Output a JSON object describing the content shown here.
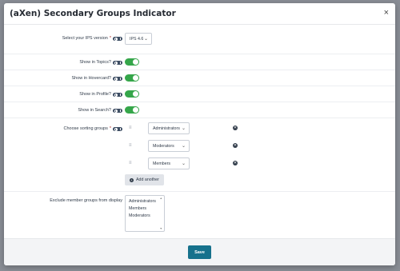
{
  "backdrop": {
    "edge_text": ""
  },
  "modal": {
    "title": "(aXen) Secondary Groups Indicator",
    "close_glyph": "×"
  },
  "fields": {
    "ips_version": {
      "label": "Select your IPS version",
      "required_mark": "*",
      "value": "IPS 4.6"
    },
    "show_topics": {
      "label": "Show in Topics?",
      "on": true
    },
    "show_hovercard": {
      "label": "Show in Hovercard?",
      "on": true
    },
    "show_profile": {
      "label": "Show in Profile?",
      "on": true
    },
    "show_search": {
      "label": "Show in Search?",
      "on": true
    },
    "sorting_groups": {
      "label": "Choose sorting groups",
      "required_mark": "*",
      "items": [
        "Administrators",
        "Moderators",
        "Members"
      ],
      "add_label": "Add another"
    },
    "exclude_groups": {
      "label": "Exclude member groups from display",
      "options": [
        "Administrators",
        "Members",
        "Moderators"
      ]
    }
  },
  "footer": {
    "save_label": "Save"
  },
  "icons": [
    "key-icon",
    "toggle-check-icon",
    "drag-handle-icon",
    "delete-icon",
    "plus-icon",
    "chevron-down-icon",
    "close-icon"
  ],
  "colors": {
    "toggle_on": "#35a64a",
    "primary_button": "#16718c",
    "badge": "#3d4d63"
  }
}
